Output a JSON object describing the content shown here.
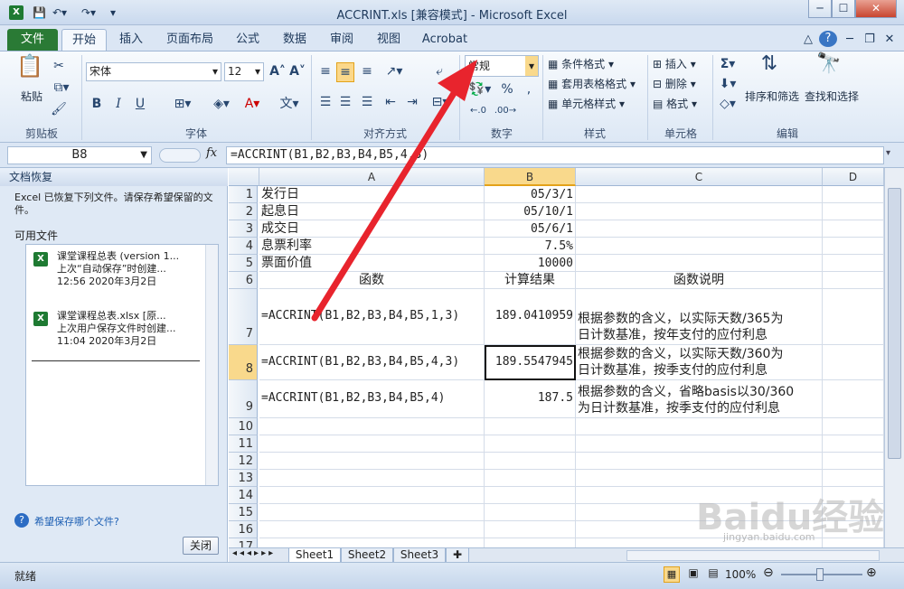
{
  "window": {
    "title": "ACCRINT.xls  [兼容模式] - Microsoft Excel",
    "excel_icon": "excel-icon",
    "qat_save": "save-icon",
    "qat_undo": "undo-icon",
    "qat_redo": "redo-icon"
  },
  "tabs": [
    "文件",
    "开始",
    "插入",
    "页面布局",
    "公式",
    "数据",
    "审阅",
    "视图",
    "Acrobat"
  ],
  "ribbon": {
    "paste_label": "粘贴",
    "font_name": "宋体",
    "font_size": "12",
    "number_format": "常规",
    "cond_format": "条件格式",
    "table_format": "套用表格格式",
    "cell_style": "单元格样式",
    "insert": "插入",
    "delete": "删除",
    "format": "格式",
    "sort_filter": "排序和筛选",
    "find_select": "查找和选择",
    "group_labels": [
      "剪贴板",
      "字体",
      "对齐方式",
      "数字",
      "样式",
      "单元格",
      "编辑"
    ],
    "bold": "B",
    "italic": "I",
    "underline": "U",
    "percent": "%",
    "comma": ",",
    "sigma": "Σ"
  },
  "formula_bar": {
    "name_box": "B8",
    "fx": "fx",
    "formula": "=ACCRINT(B1,B2,B3,B4,B5,4,3)"
  },
  "recovery_pane": {
    "title": "文档恢复",
    "message": "Excel 已恢复下列文件。请保存希望保留的文件。",
    "available": "可用文件",
    "files": [
      {
        "name": "课堂课程总表 (version 1...",
        "note": "上次“自动保存”时创建...",
        "time": "12:56 2020年3月2日"
      },
      {
        "name": "课堂课程总表.xlsx  [原...",
        "note": "上次用户保存文件时创建...",
        "time": "11:04 2020年3月2日"
      }
    ],
    "help": "希望保存哪个文件?",
    "close": "关闭"
  },
  "sheet": {
    "columns": [
      "A",
      "B",
      "C",
      "D"
    ],
    "rows": [
      {
        "n": "1",
        "a": "发行日",
        "b": "05/3/1",
        "c": ""
      },
      {
        "n": "2",
        "a": "起息日",
        "b": "05/10/1",
        "c": ""
      },
      {
        "n": "3",
        "a": "成交日",
        "b": "05/6/1",
        "c": ""
      },
      {
        "n": "4",
        "a": "息票利率",
        "b": "7.5%",
        "c": ""
      },
      {
        "n": "5",
        "a": "票面价值",
        "b": "10000",
        "c": ""
      },
      {
        "n": "6",
        "a": "函数",
        "b": "计算结果",
        "c": "函数说明"
      },
      {
        "n": "7",
        "a": "=ACCRINT(B1,B2,B3,B4,B5,1,3)",
        "b": "189.0410959",
        "c1": "根据参数的含义，以实际天数/365为",
        "c2": "日计数基准，按年支付的应付利息"
      },
      {
        "n": "8",
        "a": "=ACCRINT(B1,B2,B3,B4,B5,4,3)",
        "b": "189.5547945",
        "c1": "根据参数的含义，以实际天数/360为",
        "c2": "日计数基准，按季支付的应付利息"
      },
      {
        "n": "9",
        "a": "=ACCRINT(B1,B2,B3,B4,B5,4)",
        "b": "187.5",
        "c1": "根据参数的含义，省略basis以30/360",
        "c2": "为日计数基准，按季支付的应付利息"
      },
      {
        "n": "10"
      },
      {
        "n": "11"
      },
      {
        "n": "12"
      },
      {
        "n": "13"
      },
      {
        "n": "14"
      },
      {
        "n": "15"
      },
      {
        "n": "16"
      },
      {
        "n": "17"
      }
    ],
    "tabs": [
      "Sheet1",
      "Sheet2",
      "Sheet3"
    ]
  },
  "status": {
    "ready": "就绪",
    "zoom": "100%"
  },
  "watermark": {
    "brand": "Baidu经验",
    "url": "jingyan.baidu.com"
  }
}
